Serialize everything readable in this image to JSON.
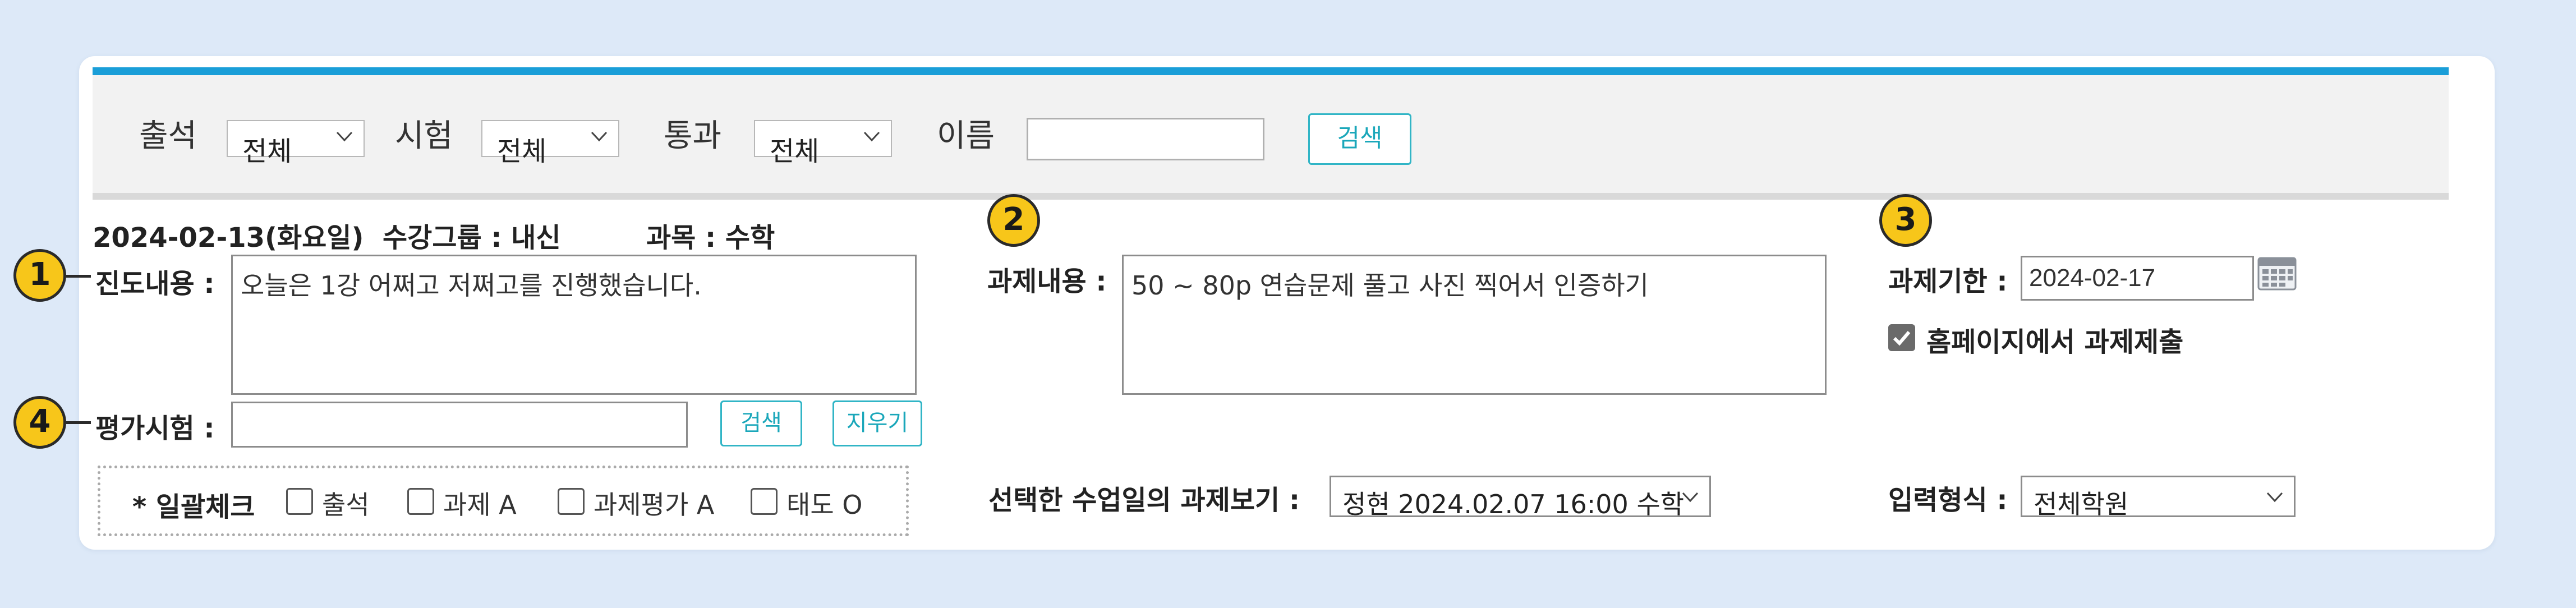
{
  "filter": {
    "attendance_label": "출석",
    "attendance_value": "전체",
    "exam_label": "시험",
    "exam_value": "전체",
    "pass_label": "통과",
    "pass_value": "전체",
    "name_label": "이름",
    "name_value": "",
    "search_button": "검색"
  },
  "lesson": {
    "date": "2024-02-13(화요일)",
    "group": "수강그룹 : 내신",
    "subject": "과목 : 수학"
  },
  "progress": {
    "label": "진도내용 :",
    "value": "오늘은 1강 어쩌고 저쩌고를 진행했습니다."
  },
  "evaluation": {
    "label": "평가시험 :",
    "value": "",
    "search_button": "검색",
    "clear_button": "지우기"
  },
  "bulk_check": {
    "label": "* 일괄체크",
    "items": [
      "출석",
      "과제 A",
      "과제평가 A",
      "태도 O"
    ]
  },
  "assignment": {
    "label": "과제내용 :",
    "value": "50 ~ 80p 연습문제 풀고 사진 찍어서 인증하기"
  },
  "view_assignment": {
    "label": "선택한 수업일의 과제보기 :",
    "value": "정현 2024.02.07 16:00 수학"
  },
  "deadline": {
    "label": "과제기한 :",
    "value": "2024-02-17",
    "homepage_submit_label": "홈페이지에서 과제제출",
    "homepage_submit_checked": true
  },
  "input_type": {
    "label": "입력형식 :",
    "value": "전체학원"
  },
  "badges": [
    "1",
    "2",
    "3",
    "4"
  ],
  "colors": {
    "accent": "#1a9ed8",
    "button_teal": "#31b5c6",
    "badge_yellow": "#f7c61a",
    "background": "#dde9f8"
  }
}
